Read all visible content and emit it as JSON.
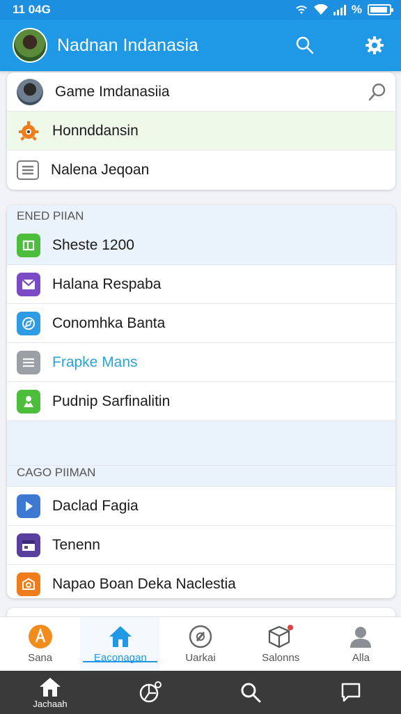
{
  "status_bar": {
    "time": "11 04G",
    "battery_label": "%"
  },
  "app_bar": {
    "title": "Nadnan Indanasia"
  },
  "top_list": [
    {
      "label": "Game Imdanasiia",
      "icon": "avatar-icon",
      "has_trailing_search": true
    },
    {
      "label": "Honnddansin",
      "icon": "orange-gear-face-icon",
      "highlighted": true
    },
    {
      "label": "Nalena Jeqoan",
      "icon": "document-lines-icon"
    }
  ],
  "section1": {
    "header": "ENED PIIAN",
    "items": [
      {
        "label": "Sheste 1200",
        "icon": "green-box-icon",
        "color": "#4cbe3c"
      },
      {
        "label": "Halana Respaba",
        "icon": "purple-mail-icon",
        "color": "#7b4bc6"
      },
      {
        "label": "Conomhka Banta",
        "icon": "blue-compass-icon",
        "color": "#2e9be3"
      },
      {
        "label": "Frapke Mans",
        "icon": "gray-list-icon",
        "color": "#9aa0a6",
        "accent_text": true
      },
      {
        "label": "Pudnip Sarfinalitin",
        "icon": "green-person-icon",
        "color": "#4cbe3c"
      }
    ]
  },
  "section2": {
    "header": "CAGO PIIMAN",
    "items": [
      {
        "label": "Daclad Fagia",
        "icon": "blue-play-icon",
        "color": "#3d79d2"
      },
      {
        "label": "Tenenn",
        "icon": "purple-calendar-icon",
        "color": "#5a3f9e"
      },
      {
        "label": "Napao Boan Deka Naclestia",
        "icon": "orange-shield-icon",
        "color": "#f07d1c"
      }
    ]
  },
  "bottom_nav": [
    {
      "label": "Sana",
      "icon": "orange-a-icon"
    },
    {
      "label": "Eaconagan",
      "icon": "home-icon",
      "active": true
    },
    {
      "label": "Uarkai",
      "icon": "disc-icon"
    },
    {
      "label": "Salonns",
      "icon": "box-icon"
    },
    {
      "label": "Alla",
      "icon": "person-icon"
    }
  ],
  "system_nav": [
    {
      "label": "Jachaah",
      "icon": "home-icon"
    },
    {
      "label": "",
      "icon": "chart-compass-icon"
    },
    {
      "label": "",
      "icon": "search-icon"
    },
    {
      "label": "",
      "icon": "chat-icon"
    }
  ],
  "colors": {
    "primary": "#1f98e6",
    "accent_text": "#2aa3d6"
  }
}
